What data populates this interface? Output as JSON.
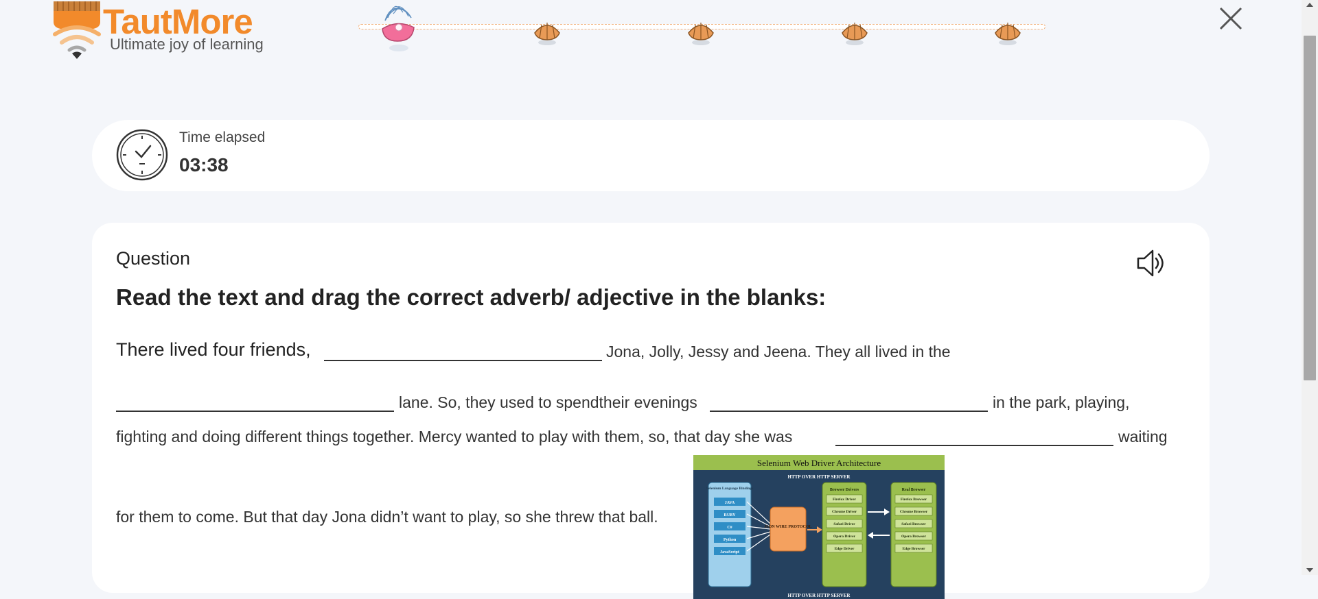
{
  "brand": {
    "name": "TautMore",
    "tagline": "Ultimate joy of learning"
  },
  "header": {
    "progress_steps": 5,
    "current_step": 1,
    "close_icon": "close-icon"
  },
  "timer": {
    "label": "Time elapsed",
    "value": "03:38",
    "icon": "clock-icon"
  },
  "question": {
    "heading": "Question",
    "instruction": "Read the text and drag the correct adverb/ adjective in the blanks:",
    "speaker_icon": "speaker-icon",
    "passage": {
      "part1": "There lived four friends,",
      "part2": "Jona, Jolly, Jessy and Jeena. They all lived in the",
      "part3": "lane. So, they used to spendtheir evenings",
      "part4": "in the park, playing,",
      "part5": "fighting and doing different things together. Mercy wanted to play with them, so, that day she was",
      "part6": "waiting",
      "part7": "for them to come. But that day Jona didn’t want to play, so she threw that ball."
    },
    "blanks": [
      "",
      "",
      "",
      ""
    ],
    "image": {
      "title": "Selenium Web Driver Architecture",
      "top_caption": "HTTP OVER HTTP SERVER",
      "bottom_caption": "HTTP OVER HTTP SERVER",
      "bindings_title": "Selenium Language Bindings",
      "bindings": [
        "JAVA",
        "RUBY",
        "C#",
        "Python",
        "JavaScript"
      ],
      "protocol": "JSON WIRE PROTOCOL",
      "drivers_title": "Browser Drivers",
      "drivers": [
        "Firefox Driver",
        "Chrome Driver",
        "Safari Driver",
        "Opera Driver",
        "Edge Driver"
      ],
      "browsers_title": "Real Browser",
      "browsers": [
        "Firefox Browser",
        "Chrome Browser",
        "Safari Browser",
        "Opera Browser",
        "Edge Browser"
      ]
    }
  },
  "colors": {
    "accent": "#f28a2b",
    "background": "#f4f6fa",
    "card": "#ffffff"
  }
}
